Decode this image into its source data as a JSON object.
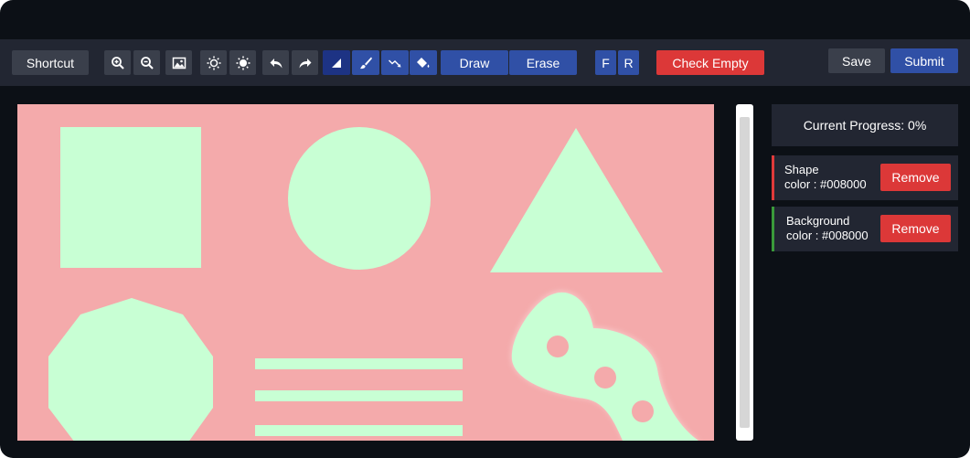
{
  "toolbar": {
    "shortcut_label": "Shortcut",
    "draw_label": "Draw",
    "erase_label": "Erase",
    "f_label": "F",
    "r_label": "R",
    "check_empty_label": "Check Empty",
    "save_label": "Save",
    "submit_label": "Submit",
    "icons": [
      "zoom-in-icon",
      "zoom-out-icon",
      "image-icon",
      "brightness-up-icon",
      "brightness-down-icon",
      "undo-icon",
      "redo-icon",
      "polygon-tool-icon",
      "brush-icon",
      "lasso-icon",
      "fill-icon"
    ]
  },
  "canvas": {
    "background_color": "#f4aaab",
    "shape_color": "#c8ffd4",
    "shapes": [
      "square",
      "circle",
      "triangle",
      "nonagon",
      "horizontal-lines",
      "blob-with-holes"
    ]
  },
  "sidebar": {
    "progress_text": "Current Progress: 0%",
    "labels": [
      {
        "line1": "Shape",
        "line2": "color : #008000",
        "remove_label": "Remove",
        "accent": "#e03a3a"
      },
      {
        "line1": "Background",
        "line2": "color : #008000",
        "remove_label": "Remove",
        "accent": "#3a9a3a"
      }
    ]
  },
  "colors": {
    "app_bg": "#0c1016",
    "toolbar_bg": "#222632",
    "button_gray": "#3a3f4b",
    "button_blue": "#3050a6",
    "button_navy": "#1d3384",
    "danger": "#dc3838"
  }
}
